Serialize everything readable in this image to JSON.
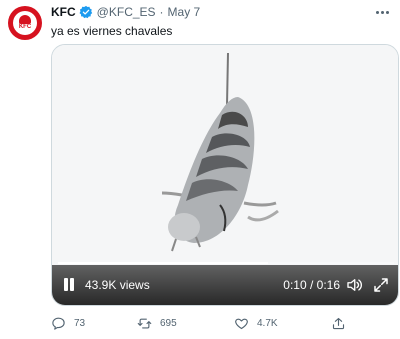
{
  "tweet": {
    "author_name": "KFC",
    "avatar_text": "KFC",
    "handle": "@KFC_ES",
    "separator": "·",
    "date": "May 7",
    "text": "ya es viernes chavales"
  },
  "video": {
    "views": "43.9K views",
    "time": "0:10 / 0:16",
    "progress": 0.625,
    "state": "playing"
  },
  "actions": {
    "replies": "73",
    "retweets": "695",
    "likes": "4.7K"
  },
  "icons": {
    "verified": "verified-badge-icon",
    "more": "more-icon",
    "pause": "pause-icon",
    "volume": "volume-icon",
    "fullscreen": "fullscreen-icon",
    "reply": "reply-icon",
    "retweet": "retweet-icon",
    "like": "heart-icon",
    "share": "share-icon"
  },
  "colors": {
    "brand_red": "#d6121f",
    "verified_blue": "#1d9bf0",
    "text_primary": "#0f1419",
    "text_secondary": "#536471"
  }
}
